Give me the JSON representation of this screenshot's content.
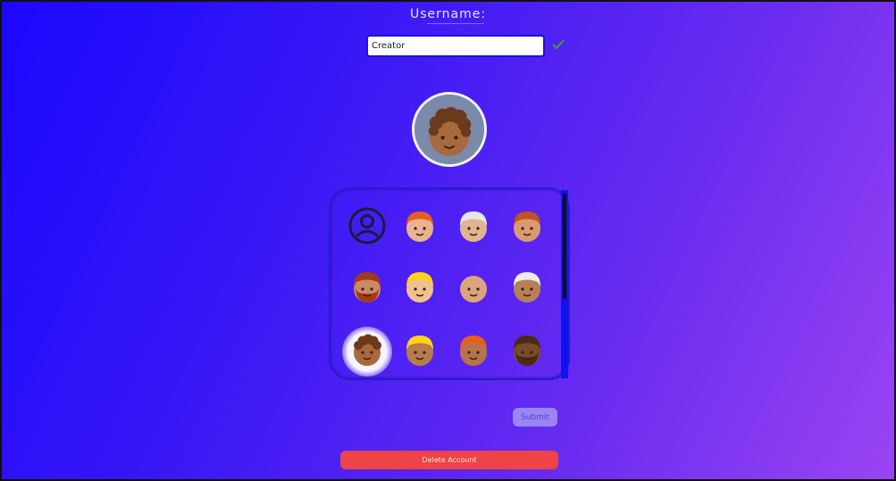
{
  "header": {
    "title": "Username:"
  },
  "username": {
    "value": "Creator"
  },
  "preview": {
    "label": "curly-hair-face"
  },
  "avatars": [
    {
      "name": "default-user-icon"
    },
    {
      "name": "face-red-hair-light"
    },
    {
      "name": "face-white-hair-light"
    },
    {
      "name": "face-red-hair-medium"
    },
    {
      "name": "face-beard-red"
    },
    {
      "name": "face-blond-light"
    },
    {
      "name": "face-bald-medium"
    },
    {
      "name": "face-white-hair-medium"
    },
    {
      "name": "face-curly-medium"
    },
    {
      "name": "face-blond-medium"
    },
    {
      "name": "face-red-hair-dark"
    },
    {
      "name": "face-beard-dark"
    }
  ],
  "selected_avatar_index": 8,
  "buttons": {
    "submit": "Submit",
    "delete": "Delete Account"
  },
  "colors": {
    "accent": "#1a08ff",
    "delete": "#ee4347",
    "submit": "#9a85f4",
    "check": "#2fa24a"
  }
}
